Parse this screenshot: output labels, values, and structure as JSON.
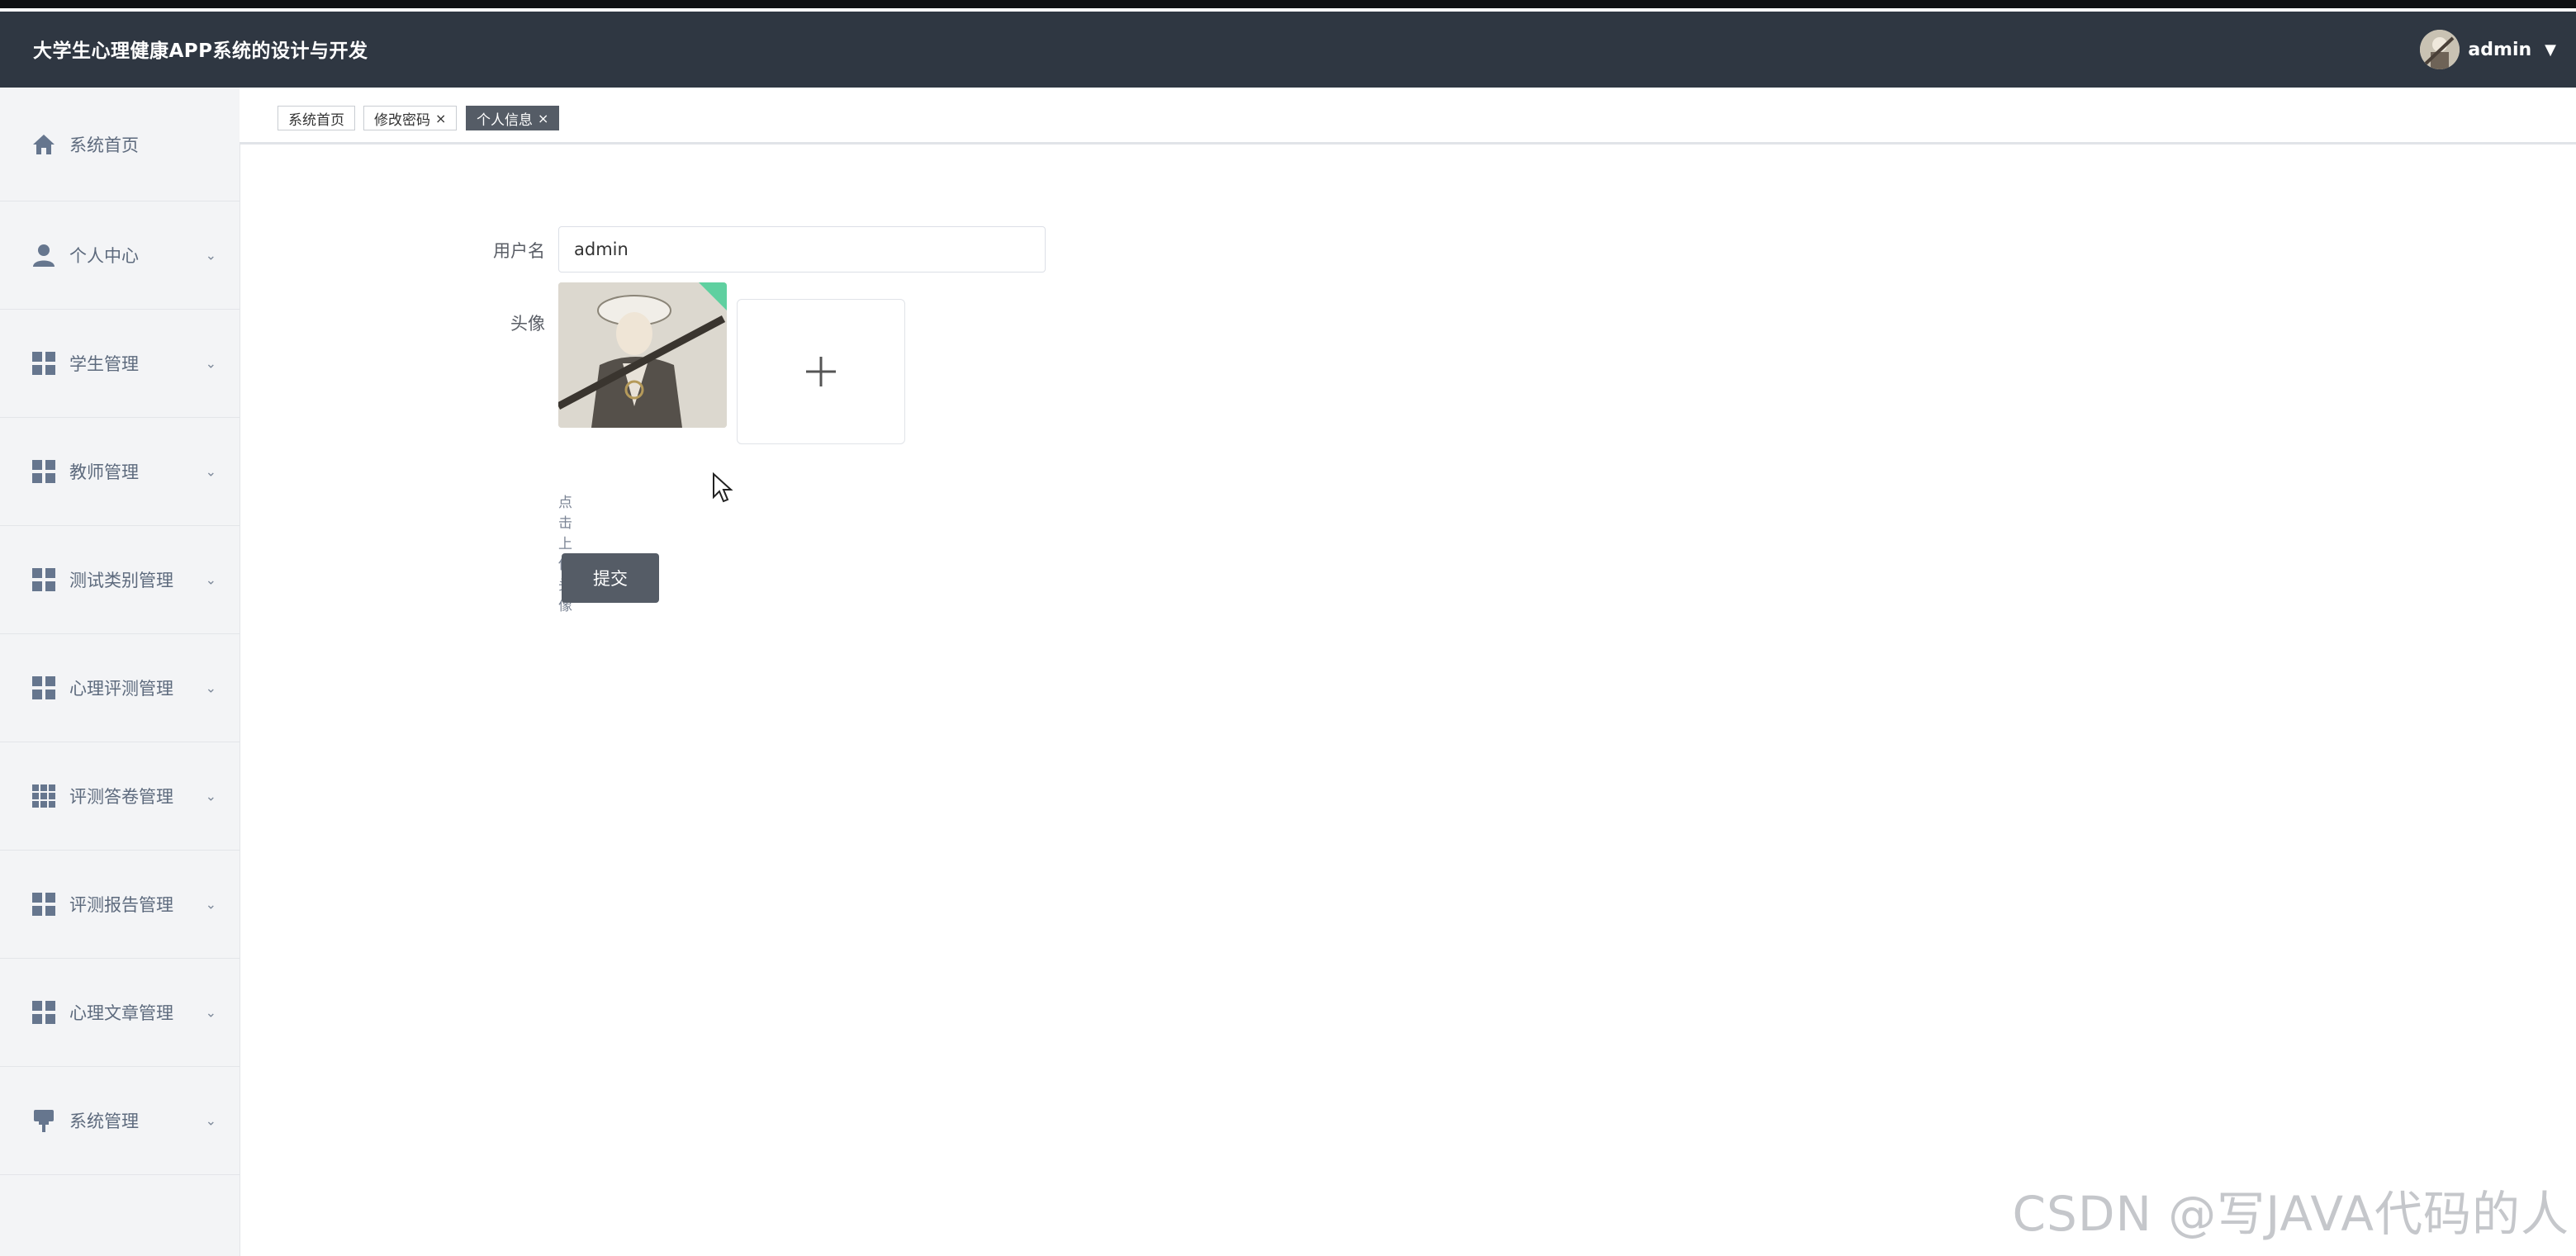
{
  "app": {
    "title": "大学生心理健康APP系统的设计与开发"
  },
  "user": {
    "name": "admin"
  },
  "sidebar": {
    "items": [
      {
        "label": "系统首页",
        "icon": "home-icon",
        "expandable": false
      },
      {
        "label": "个人中心",
        "icon": "person-icon",
        "expandable": true
      },
      {
        "label": "学生管理",
        "icon": "grid-icon",
        "expandable": true
      },
      {
        "label": "教师管理",
        "icon": "grid-icon",
        "expandable": true
      },
      {
        "label": "测试类别管理",
        "icon": "grid-icon",
        "expandable": true
      },
      {
        "label": "心理评测管理",
        "icon": "grid-icon",
        "expandable": true
      },
      {
        "label": "评测答卷管理",
        "icon": "grid9-icon",
        "expandable": true
      },
      {
        "label": "评测报告管理",
        "icon": "grid-icon",
        "expandable": true
      },
      {
        "label": "心理文章管理",
        "icon": "grid-icon",
        "expandable": true
      },
      {
        "label": "系统管理",
        "icon": "brush-icon",
        "expandable": true
      }
    ]
  },
  "tabs": [
    {
      "label": "系统首页",
      "closable": false,
      "active": false
    },
    {
      "label": "修改密码",
      "closable": true,
      "active": false
    },
    {
      "label": "个人信息",
      "closable": true,
      "active": true
    }
  ],
  "form": {
    "username_label": "用户名",
    "username_value": "admin",
    "avatar_label": "头像",
    "upload_hint": "点击上传头像",
    "submit_label": "提交"
  },
  "watermark": "CSDN @写JAVA代码的人",
  "colors": {
    "header_bg": "#2f3742",
    "accent": "#555c66",
    "sidebar_bg": "#f3f4f6"
  }
}
